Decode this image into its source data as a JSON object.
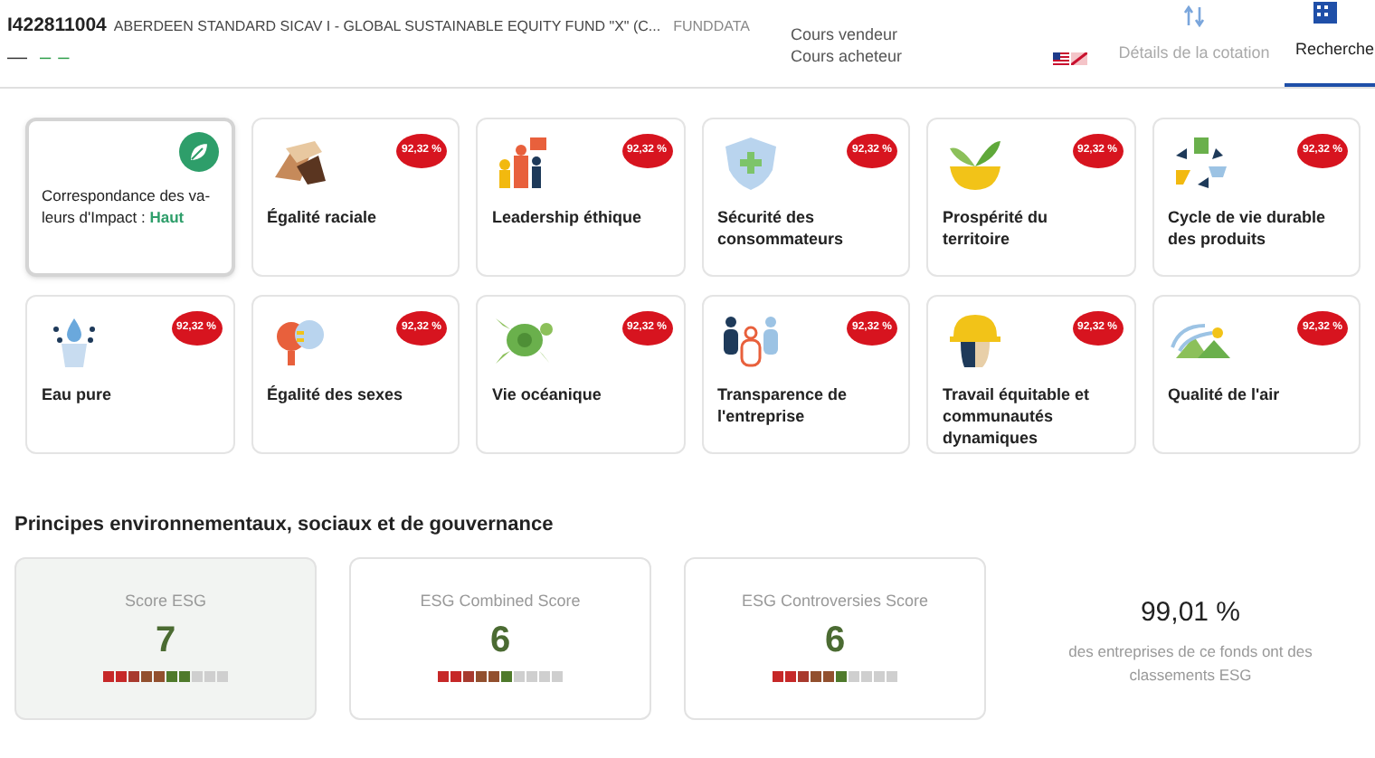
{
  "header": {
    "code": "I422811004",
    "fund_name": "ABERDEEN STANDARD SICAV I - GLOBAL SUSTAINABLE EQUITY FUND \"X\" (C...",
    "source": "FUNDDATA",
    "price_values": [
      {
        "text": "—",
        "kind": "last"
      },
      {
        "text": "–",
        "kind": "change"
      },
      {
        "text": "–",
        "kind": "change"
      }
    ],
    "price_labels": [
      "Cours vendeur",
      "Cours acheteur"
    ],
    "tabs": [
      {
        "label": "Détails de la cotation",
        "selected": false
      },
      {
        "label": "Recherche",
        "selected": true
      }
    ]
  },
  "impact_cards": [
    {
      "kind": "summary",
      "label": "Correspondance des va-leurs d'Impact : ",
      "rating": "Haut"
    },
    {
      "kind": "theme",
      "label": "Égalité raciale",
      "badge": "92,32 %"
    },
    {
      "kind": "theme",
      "label": "Leadership éthique",
      "badge": "92,32 %"
    },
    {
      "kind": "theme",
      "label": "Sécurité des consommateurs",
      "badge": "92,32 %"
    },
    {
      "kind": "theme",
      "label": "Prospérité du territoire",
      "badge": "92,32 %"
    },
    {
      "kind": "theme",
      "label": "Cycle de vie durable des produits",
      "badge": "92,32 %"
    },
    {
      "kind": "theme",
      "label": "Eau pure",
      "badge": "92,32 %"
    },
    {
      "kind": "theme",
      "label": "Égalité des sexes",
      "badge": "92,32 %"
    },
    {
      "kind": "theme",
      "label": "Vie océanique",
      "badge": "92,32 %"
    },
    {
      "kind": "theme",
      "label": "Transparence de l'entreprise",
      "badge": "92,32 %"
    },
    {
      "kind": "theme",
      "label": "Travail équitable et communautés dynamiques",
      "badge": "92,32 %"
    },
    {
      "kind": "theme",
      "label": "Qualité de l'air",
      "badge": "92,32 %"
    }
  ],
  "esg": {
    "title": "Principes environnementaux, sociaux et de gouvernance",
    "scores": [
      {
        "label": "Score ESG",
        "value": "7",
        "level": 0.7,
        "selected": true
      },
      {
        "label": "ESG Combined Score",
        "value": "6",
        "level": 0.6,
        "selected": false
      },
      {
        "label": "ESG Controversies Score",
        "value": "6",
        "level": 0.6,
        "selected": false
      }
    ],
    "coverage": {
      "value": "99,01 %",
      "caption": "des entreprises de ce fonds ont des classements ESG"
    }
  }
}
